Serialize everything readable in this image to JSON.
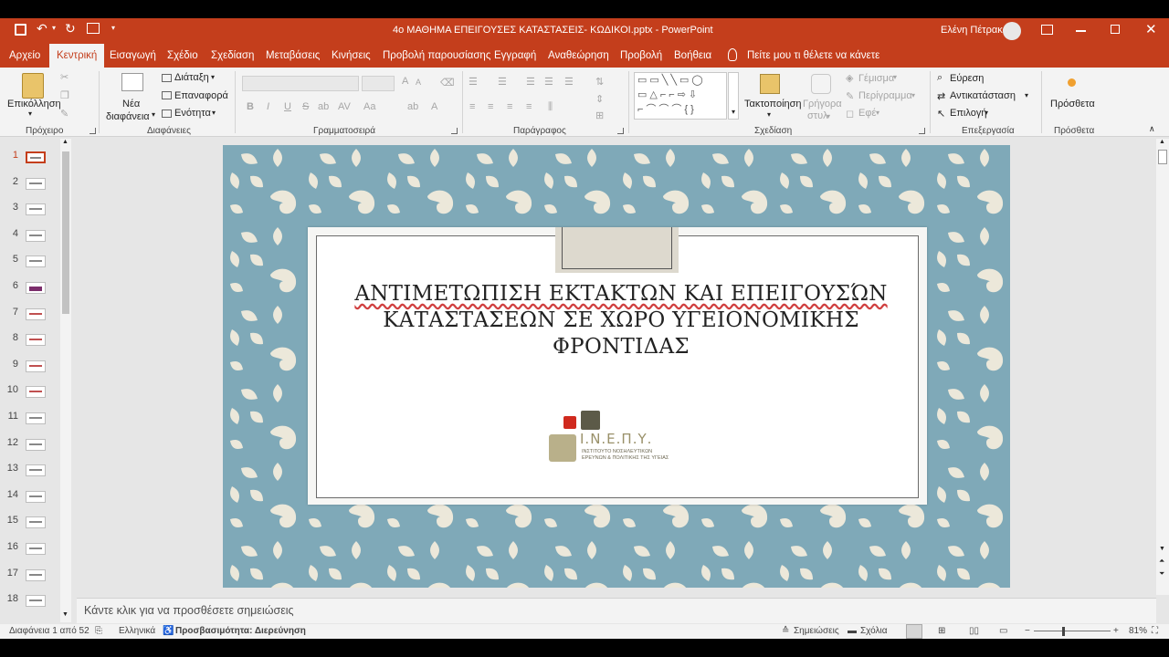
{
  "window": {
    "title": "4ο ΜΑΘΗΜΑ ΕΠΕΙΓΟΥΣΕΣ ΚΑΤΑΣΤΑΣΕΙΣ- ΚΩΔΙΚΟΙ.pptx  -  PowerPoint",
    "user": "Ελένη Πέτρακα"
  },
  "tabs": [
    "Αρχείο",
    "Κεντρική",
    "Εισαγωγή",
    "Σχέδιο",
    "Σχεδίαση",
    "Μεταβάσεις",
    "Κινήσεις",
    "Προβολή παρουσίασης",
    "Εγγραφή",
    "Αναθεώρηση",
    "Προβολή",
    "Βοήθεια"
  ],
  "tell_me": "Πείτε μου τι θέλετε να κάνετε",
  "ribbon": {
    "clipboard": {
      "paste": "Επικόλληση",
      "label": "Πρόχειρο"
    },
    "slides": {
      "new_slide_1": "Νέα",
      "new_slide_2": "διαφάνεια",
      "layout": "Διάταξη",
      "reset": "Επαναφορά",
      "section": "Ενότητα",
      "label": "Διαφάνειες"
    },
    "font": {
      "bold": "B",
      "italic": "I",
      "underline": "U",
      "strike": "S",
      "label": "Γραμματοσειρά"
    },
    "paragraph": {
      "label": "Παράγραφος"
    },
    "drawing": {
      "arrange_1": "Τακτοποίηση",
      "quick_1": "Γρήγορα",
      "quick_2": "στυλ",
      "fill": "Γέμισμα",
      "outline": "Περίγραμμα",
      "effect": "Εφέ",
      "label": "Σχεδίαση"
    },
    "editing": {
      "find": "Εύρεση",
      "replace": "Αντικατάσταση",
      "select": "Επιλογή",
      "label": "Επεξεργασία"
    },
    "addins": {
      "addins": "Πρόσθετα",
      "label": "Πρόσθετα"
    }
  },
  "thumbnails": [
    "1",
    "2",
    "3",
    "4",
    "5",
    "6",
    "7",
    "8",
    "9",
    "10",
    "11",
    "12",
    "13",
    "14",
    "15",
    "16",
    "17",
    "18"
  ],
  "slide": {
    "title_lines": [
      "ΑΝΤΙΜΕΤΩΠΙΣΗ ΕΚΤΑΚΤΩΝ ΚΑΙ ΕΠΕΙΓΟΥΣΏΝ",
      "ΚΑΤΑΣΤΑΣΕΩΝ ΣΕ ΧΩΡΟ ΥΓΕΙΟΝΟΜΙΚΗΣ",
      "ΦΡΟΝΤΙΔΑΣ"
    ],
    "logo_name": "Ι.Ν.Ε.Π.Υ.",
    "logo_sub_1": "ΙΝΣΤΙΤΟΥΤΟ ΝΟΣΗΛΕΥΤΙΚΩΝ",
    "logo_sub_2": "ΕΡΕΥΝΩΝ & ΠΟΛΙΤΙΚΗΣ ΤΗΣ ΥΓΕΙΑΣ"
  },
  "notes_placeholder": "Κάντε κλικ για να προσθέσετε σημειώσεις",
  "status": {
    "slide_count": "Διαφάνεια 1 από 52",
    "language": "Ελληνικά",
    "accessibility": "Προσβασιμότητα: Διερεύνηση",
    "notes": "Σημειώσεις",
    "comments": "Σχόλια",
    "zoom": "81%"
  },
  "colors": {
    "accent": "#c43e1c",
    "slide_bg": "#7fa9b8",
    "leaf": "#ece8da"
  }
}
